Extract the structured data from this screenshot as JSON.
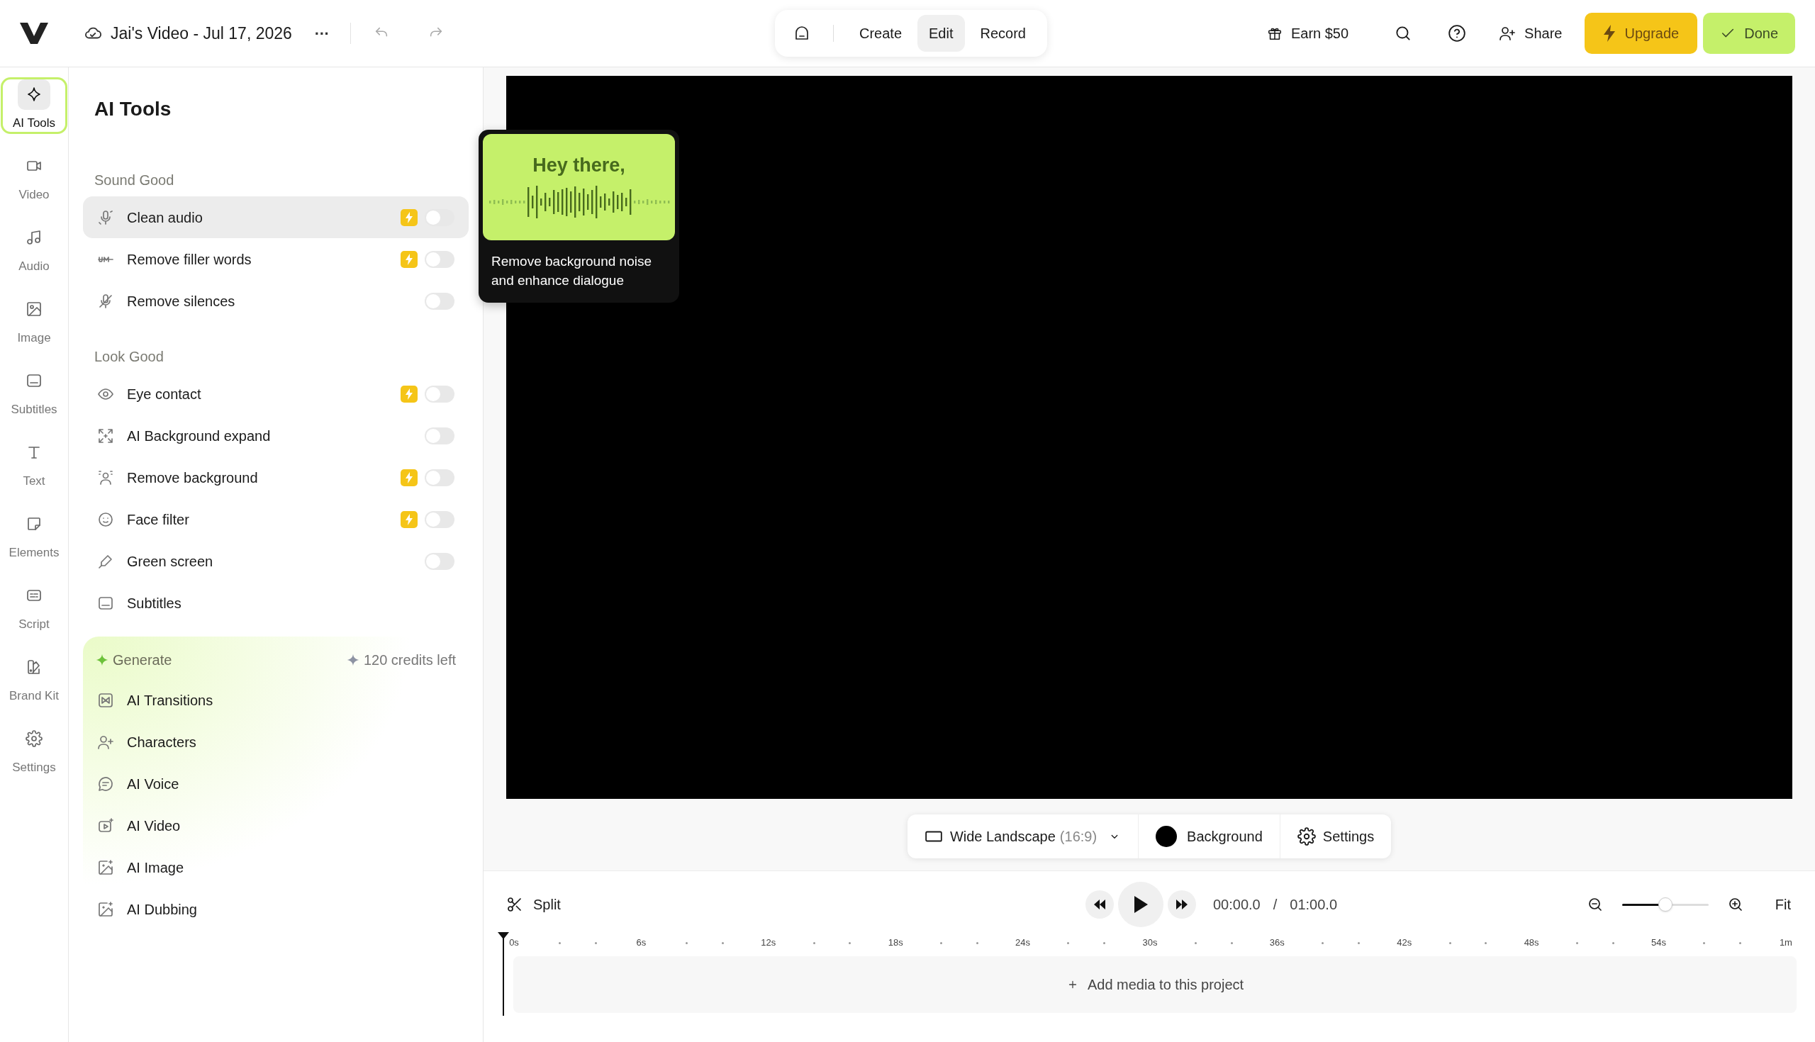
{
  "header": {
    "title": "Jai's Video - Jul 17, 2026",
    "more": "···",
    "modes": [
      {
        "label": "Create",
        "selected": false
      },
      {
        "label": "Edit",
        "selected": true
      },
      {
        "label": "Record",
        "selected": false
      }
    ],
    "earn": "Earn $50",
    "share": "Share",
    "upgrade": "Upgrade",
    "done": "Done"
  },
  "nav": [
    {
      "label": "AI Tools",
      "selected": true
    },
    {
      "label": "Video",
      "selected": false
    },
    {
      "label": "Audio",
      "selected": false
    },
    {
      "label": "Image",
      "selected": false
    },
    {
      "label": "Subtitles",
      "selected": false
    },
    {
      "label": "Text",
      "selected": false
    },
    {
      "label": "Elements",
      "selected": false
    },
    {
      "label": "Script",
      "selected": false
    },
    {
      "label": "Brand Kit",
      "selected": false
    },
    {
      "label": "Settings",
      "selected": false
    }
  ],
  "panel": {
    "title": "AI Tools",
    "sections": [
      {
        "kind": "plain",
        "heading": "Sound Good",
        "items": [
          {
            "label": "Clean audio",
            "kind": "toggle",
            "premium": true,
            "on": false,
            "highlighted": true
          },
          {
            "label": "Remove filler words",
            "kind": "toggle",
            "premium": true,
            "on": false,
            "highlighted": false
          },
          {
            "label": "Remove silences",
            "kind": "toggle",
            "premium": false,
            "on": false,
            "highlighted": false
          }
        ]
      },
      {
        "kind": "plain",
        "heading": "Look Good",
        "items": [
          {
            "label": "Eye contact",
            "kind": "toggle",
            "premium": true,
            "on": false,
            "highlighted": false
          },
          {
            "label": "AI Background expand",
            "kind": "toggle",
            "premium": false,
            "on": false,
            "highlighted": false
          },
          {
            "label": "Remove background",
            "kind": "toggle",
            "premium": true,
            "on": false,
            "highlighted": false
          },
          {
            "label": "Face filter",
            "kind": "toggle",
            "premium": true,
            "on": false,
            "highlighted": false
          },
          {
            "label": "Green screen",
            "kind": "toggle",
            "premium": false,
            "on": false,
            "highlighted": false
          },
          {
            "label": "Subtitles",
            "kind": "link",
            "highlighted": false
          }
        ]
      },
      {
        "kind": "generate",
        "heading": "Generate",
        "credits": "120 credits left",
        "items": [
          {
            "label": "AI Transitions",
            "kind": "link",
            "highlighted": false
          },
          {
            "label": "Characters",
            "kind": "link",
            "highlighted": false
          },
          {
            "label": "AI Voice",
            "kind": "link",
            "highlighted": false
          },
          {
            "label": "AI Video",
            "kind": "link",
            "highlighted": false
          },
          {
            "label": "AI Image",
            "kind": "link",
            "highlighted": false
          },
          {
            "label": "AI Dubbing",
            "kind": "link",
            "highlighted": false
          }
        ]
      }
    ]
  },
  "tooltip": {
    "heading": "Hey there,",
    "text": "Remove background noise and enhance dialogue"
  },
  "canvas_bar": {
    "aspect": "Wide Landscape",
    "ratio": "(16:9)",
    "background": "Background",
    "settings": "Settings"
  },
  "timeline": {
    "split": "Split",
    "current": "00:00.0",
    "separator": "/",
    "total": "01:00.0",
    "zoom": {
      "level": 0.5
    },
    "fit": "Fit",
    "ticks": [
      "0s",
      "6s",
      "12s",
      "18s",
      "24s",
      "30s",
      "36s",
      "42s",
      "48s",
      "54s",
      "1m"
    ],
    "add_media": "Add media to this project"
  }
}
